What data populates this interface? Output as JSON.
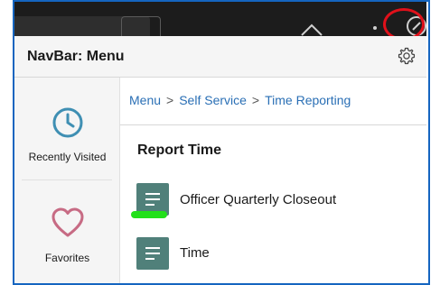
{
  "header": {
    "title": "NavBar: Menu"
  },
  "sidebar": {
    "items": [
      {
        "label": "Recently Visited",
        "icon": "clock-icon"
      },
      {
        "label": "Favorites",
        "icon": "heart-icon"
      }
    ]
  },
  "breadcrumb": {
    "items": [
      "Menu",
      "Self Service",
      "Time Reporting"
    ]
  },
  "content": {
    "section_title": "Report Time",
    "items": [
      {
        "label": "Officer Quarterly Closeout",
        "icon": "document-lines-icon"
      },
      {
        "label": "Time",
        "icon": "document-lines-icon"
      }
    ]
  },
  "colors": {
    "accent": "#2a6fb5",
    "tile": "#50807a",
    "annotation_red": "#e0101a",
    "annotation_green": "#22e01a"
  }
}
